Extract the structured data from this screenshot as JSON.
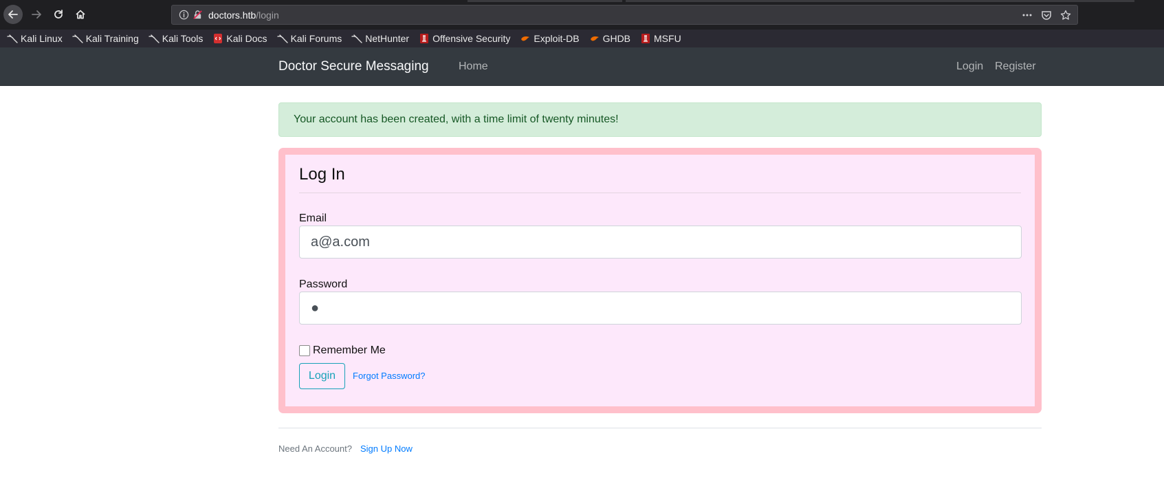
{
  "browser": {
    "url_host": "doctors.htb",
    "url_path": "/login",
    "bookmarks": [
      {
        "label": "Kali Linux",
        "icon": "kali-dragon-icon"
      },
      {
        "label": "Kali Training",
        "icon": "kali-dragon-icon"
      },
      {
        "label": "Kali Tools",
        "icon": "kali-dragon-icon"
      },
      {
        "label": "Kali Docs",
        "icon": "kali-docs-icon"
      },
      {
        "label": "Kali Forums",
        "icon": "kali-dragon-icon"
      },
      {
        "label": "NetHunter",
        "icon": "kali-dragon-icon"
      },
      {
        "label": "Offensive Security",
        "icon": "offsec-icon"
      },
      {
        "label": "Exploit-DB",
        "icon": "exploitdb-icon"
      },
      {
        "label": "GHDB",
        "icon": "ghdb-icon"
      },
      {
        "label": "MSFU",
        "icon": "offsec-icon"
      }
    ]
  },
  "navbar": {
    "brand": "Doctor Secure Messaging",
    "home": "Home",
    "login": "Login",
    "register": "Register"
  },
  "alert": {
    "message": "Your account has been created, with a time limit of twenty minutes!"
  },
  "form": {
    "legend": "Log In",
    "email_label": "Email",
    "email_value": "a@a.com",
    "password_label": "Password",
    "password_value": "●",
    "remember_label": "Remember Me",
    "submit_label": "Login",
    "forgot_label": "Forgot Password?"
  },
  "footer": {
    "prompt": "Need An Account?",
    "signup": "Sign Up Now"
  },
  "colors": {
    "navbar_bg": "#343a40",
    "alert_bg": "#d4edda",
    "alert_text": "#155724",
    "card_border": "#ffc0cb",
    "card_bg": "#fde8fb",
    "button_outline": "#17a2b8",
    "link": "#007bff"
  }
}
